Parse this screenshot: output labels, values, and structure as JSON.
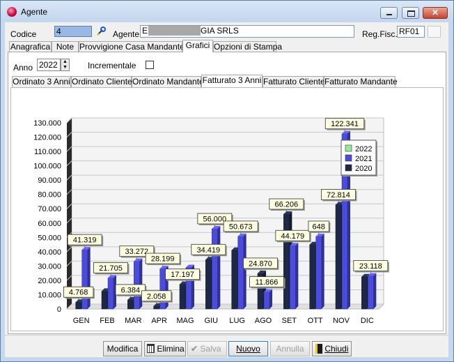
{
  "window": {
    "title": "Agente"
  },
  "header": {
    "codice_label": "Codice",
    "codice_value": "4",
    "agente_label": "Agente",
    "agente_value_prefix": "E",
    "agente_value_suffix": "GIA SRLS",
    "regfisc_label": "Reg.Fisc.",
    "regfisc_value": "RF01"
  },
  "main_tabs": [
    "Anagrafica",
    "Note",
    "Provvigione Casa Mandante",
    "Grafici",
    "Opzioni di Stampa"
  ],
  "main_tab_active": "Grafici",
  "filters": {
    "anno_label": "Anno",
    "anno_value": "2022",
    "incrementale_label": "Incrementale",
    "incrementale_checked": false
  },
  "sub_tabs": [
    "Ordinato 3 Anni",
    "Ordinato Cliente",
    "Ordinato Mandante",
    "Fatturato 3 Anni",
    "Fatturato Cliente",
    "Fatturato Mandante"
  ],
  "sub_tab_active": "Fatturato 3 Anni",
  "chart_data": {
    "type": "bar",
    "categories": [
      "GEN",
      "FEB",
      "MAR",
      "APR",
      "MAG",
      "GIU",
      "LUG",
      "AGO",
      "SET",
      "OTT",
      "NOV",
      "DIC"
    ],
    "series": [
      {
        "name": "2022",
        "color": "#90ee90",
        "values": [
          0,
          0,
          0,
          0,
          0,
          0,
          0,
          0,
          0,
          0,
          0,
          0
        ]
      },
      {
        "name": "2021",
        "color": "#4b4bdd",
        "values": [
          41319,
          21705,
          33272,
          28199,
          29000,
          56000,
          50673,
          11866,
          44179,
          50648,
          122341,
          23118
        ]
      },
      {
        "name": "2020",
        "color": "#1c2844",
        "values": [
          4768,
          12500,
          6384,
          2058,
          17197,
          34419,
          41000,
          24870,
          66206,
          45000,
          72814,
          22500
        ]
      }
    ],
    "labels": [
      {
        "cat": "GEN",
        "series": "2021",
        "text": "41.319"
      },
      {
        "cat": "GEN",
        "series": "2020",
        "text": "4.768"
      },
      {
        "cat": "FEB",
        "series": "2021",
        "text": "21.705"
      },
      {
        "cat": "MAR",
        "series": "2021",
        "text": "33.272"
      },
      {
        "cat": "MAR",
        "series": "2020",
        "text": "6.384"
      },
      {
        "cat": "APR",
        "series": "2021",
        "text": "28.199"
      },
      {
        "cat": "APR",
        "series": "2020",
        "text": "2.058"
      },
      {
        "cat": "MAG",
        "series": "2020",
        "text": "17.197"
      },
      {
        "cat": "GIU",
        "series": "2021",
        "text": "56.000"
      },
      {
        "cat": "GIU",
        "series": "2020",
        "text": "34.419"
      },
      {
        "cat": "LUG",
        "series": "2021",
        "text": "50.673"
      },
      {
        "cat": "AGO",
        "series": "2021",
        "text": "11.866"
      },
      {
        "cat": "AGO",
        "series": "2020",
        "text": "24.870"
      },
      {
        "cat": "SET",
        "series": "2021",
        "text": "44.179"
      },
      {
        "cat": "SET",
        "series": "2020",
        "text": "66.206"
      },
      {
        "cat": "OTT",
        "series": "2021",
        "text": "648"
      },
      {
        "cat": "NOV",
        "series": "2021",
        "text": "122.341"
      },
      {
        "cat": "NOV",
        "series": "2020",
        "text": "72.814"
      },
      {
        "cat": "DIC",
        "series": "2021",
        "text": "23.118"
      }
    ],
    "ylim": [
      0,
      130000
    ],
    "yticks": [
      0,
      10000,
      20000,
      30000,
      40000,
      50000,
      60000,
      70000,
      80000,
      90000,
      100000,
      110000,
      120000,
      130000
    ],
    "ytick_labels": [
      "0",
      "10.000",
      "20.000",
      "30.000",
      "40.000",
      "50.000",
      "60.000",
      "70.000",
      "80.000",
      "90.000",
      "100.000",
      "110.000",
      "120.000",
      "130.000"
    ],
    "grid": true,
    "legend_position": "right",
    "title": "",
    "xlabel": "",
    "ylabel": ""
  },
  "buttons": {
    "modifica": "Modifica",
    "elimina": "Elimina",
    "salva": "Salva",
    "nuovo": "Nuovo",
    "annulla": "Annulla",
    "chiudi": "Chiudi"
  }
}
